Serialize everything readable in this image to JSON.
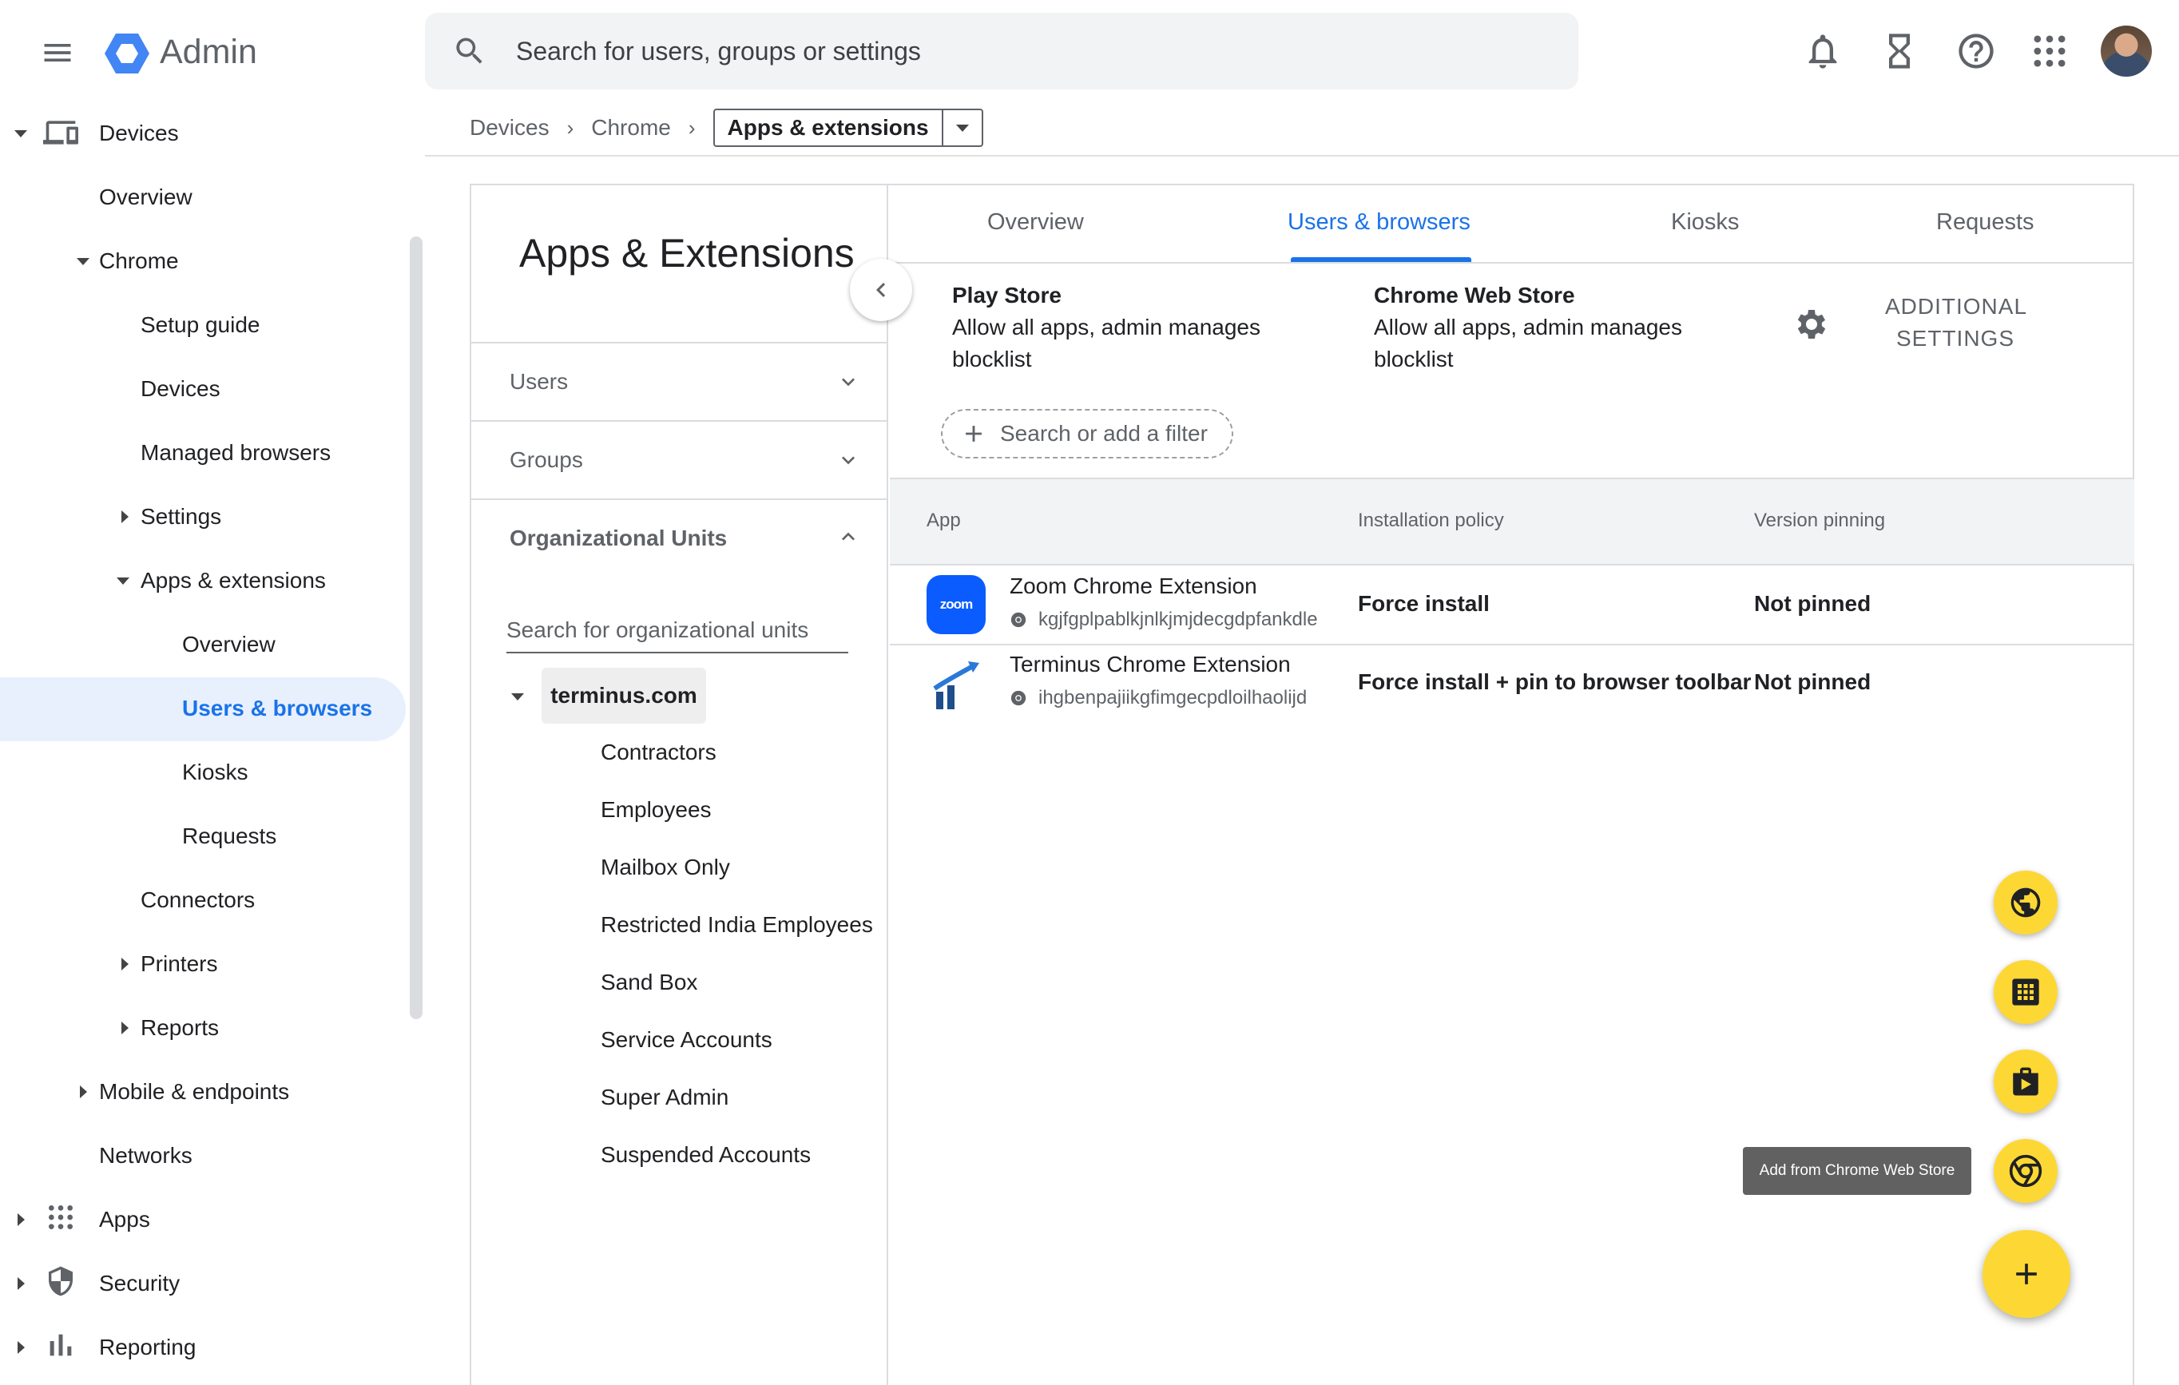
{
  "header": {
    "app_title": "Admin",
    "search_placeholder": "Search for users, groups or settings"
  },
  "breadcrumb": {
    "items": [
      "Devices",
      "Chrome"
    ],
    "current": "Apps & extensions"
  },
  "sidebar": {
    "items": [
      {
        "label": "Devices"
      },
      {
        "label": "Overview"
      },
      {
        "label": "Chrome"
      },
      {
        "label": "Setup guide"
      },
      {
        "label": "Devices"
      },
      {
        "label": "Managed browsers"
      },
      {
        "label": "Settings"
      },
      {
        "label": "Apps & extensions"
      },
      {
        "label": "Overview"
      },
      {
        "label": "Users & browsers"
      },
      {
        "label": "Kiosks"
      },
      {
        "label": "Requests"
      },
      {
        "label": "Connectors"
      },
      {
        "label": "Printers"
      },
      {
        "label": "Reports"
      },
      {
        "label": "Mobile & endpoints"
      },
      {
        "label": "Networks"
      },
      {
        "label": "Apps"
      },
      {
        "label": "Security"
      },
      {
        "label": "Reporting"
      }
    ],
    "active_color": "#1a73e8",
    "active_bg": "#e8f0fe"
  },
  "ou_panel": {
    "title": "Apps & Extensions",
    "users_label": "Users",
    "groups_label": "Groups",
    "ou_label": "Organizational Units",
    "search_placeholder": "Search for organizational units",
    "root": "terminus.com",
    "children": [
      "Contractors",
      "Employees",
      "Mailbox Only",
      "Restricted India Employees",
      "Sand Box",
      "Service Accounts",
      "Super Admin",
      "Suspended Accounts"
    ]
  },
  "tabs": [
    {
      "label": "Overview"
    },
    {
      "label": "Users & browsers"
    },
    {
      "label": "Kiosks"
    },
    {
      "label": "Requests"
    }
  ],
  "stores": {
    "play": {
      "name": "Play Store",
      "desc_1": "Allow all apps, admin manages",
      "desc_2": "blocklist"
    },
    "chrome": {
      "name": "Chrome Web Store",
      "desc_1": "Allow all apps, admin manages",
      "desc_2": "blocklist"
    },
    "additional_1": "ADDITIONAL",
    "additional_2": "SETTINGS"
  },
  "filter": {
    "label": "Search or add a filter"
  },
  "table": {
    "headers": [
      "App",
      "Installation policy",
      "Version pinning"
    ],
    "rows": [
      {
        "name": "Zoom Chrome Extension",
        "id": "kgjfgplpablkjnlkjmjdecgdpfankdle",
        "policy": "Force install",
        "pinning": "Not pinned",
        "logo_text": "zoom"
      },
      {
        "name": "Terminus Chrome Extension",
        "id": "ihgbenpajiikgfimgecpdloilhaolijd",
        "policy": "Force install + pin to browser toolbar",
        "pinning": "Not pinned"
      }
    ]
  },
  "fab": {
    "tooltip": "Add from Chrome Web Store",
    "color": "#fdd835",
    "icons": [
      "globe-icon",
      "apps-grid-icon",
      "play-bag-icon",
      "chrome-icon",
      "plus-icon"
    ]
  },
  "colors": {
    "accent": "#1a73e8",
    "logo_blue": "#4285f4",
    "zoom_blue": "#0b5cff"
  }
}
